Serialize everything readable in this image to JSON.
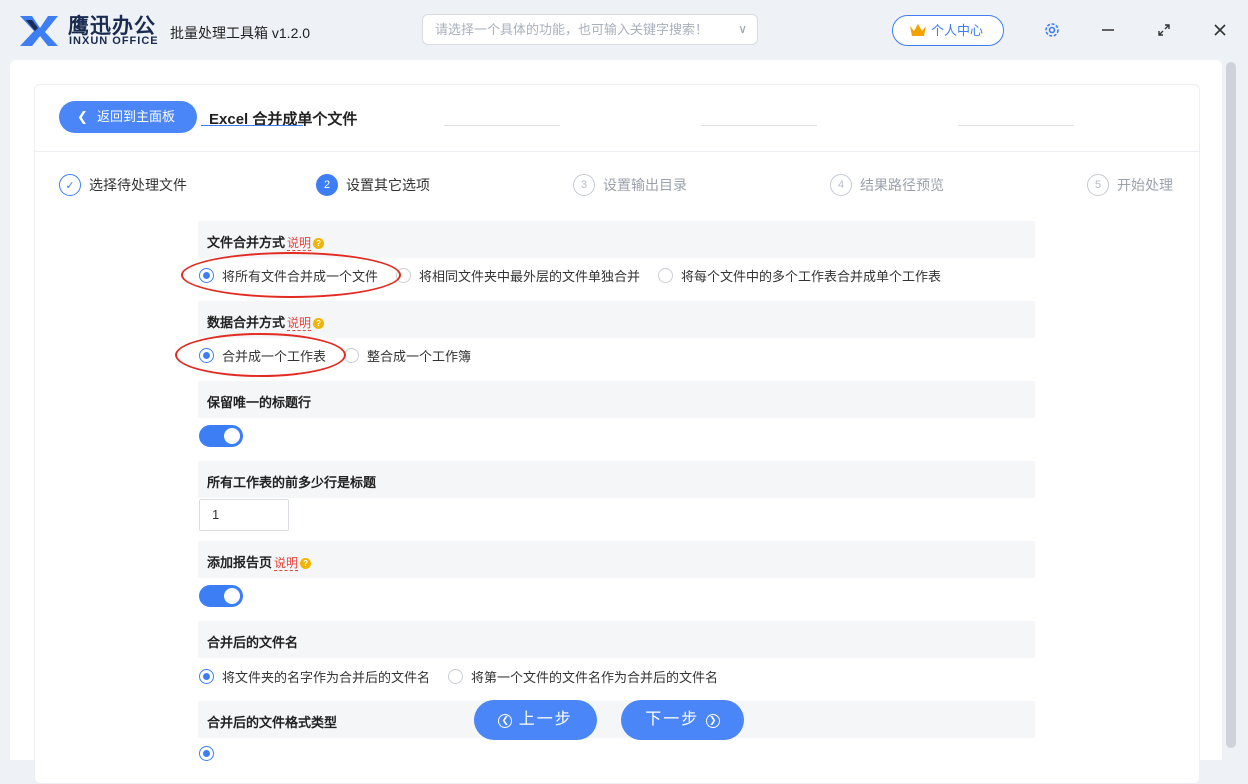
{
  "header": {
    "brand_cn": "鹰迅办公",
    "brand_en": "INXUN OFFICE",
    "app_title": "批量处理工具箱 v1.2.0",
    "search_placeholder": "请选择一个具体的功能，也可输入关键字搜索！",
    "user_center": "个人中心",
    "accent": "#3d7ef5"
  },
  "toolbar": {
    "back_label": "返回到主面板",
    "page_title": "Excel 合并成单个文件"
  },
  "steps": [
    {
      "num": "✓",
      "label": "选择待处理文件",
      "state": "done"
    },
    {
      "num": "2",
      "label": "设置其它选项",
      "state": "active"
    },
    {
      "num": "3",
      "label": "设置输出目录",
      "state": "todo"
    },
    {
      "num": "4",
      "label": "结果路径预览",
      "state": "todo"
    },
    {
      "num": "5",
      "label": "开始处理",
      "state": "todo"
    }
  ],
  "sections": {
    "file_merge": {
      "title": "文件合并方式",
      "tip": "说明",
      "options": [
        "将所有文件合并成一个文件",
        "将相同文件夹中最外层的文件单独合并",
        "将每个文件中的多个工作表合并成单个工作表"
      ],
      "selected": 0
    },
    "data_merge": {
      "title": "数据合并方式",
      "tip": "说明",
      "options": [
        "合并成一个工作表",
        "整合成一个工作簿"
      ],
      "selected": 0
    },
    "keep_header": {
      "title": "保留唯一的标题行",
      "on": true
    },
    "header_rows": {
      "title": "所有工作表的前多少行是标题",
      "value": "1"
    },
    "report_page": {
      "title": "添加报告页",
      "tip": "说明",
      "on": true
    },
    "file_name": {
      "title": "合并后的文件名",
      "options": [
        "将文件夹的名字作为合并后的文件名",
        "将第一个文件的文件名作为合并后的文件名"
      ],
      "selected": 0
    },
    "file_format": {
      "title": "合并后的文件格式类型"
    }
  },
  "nav": {
    "prev_label": "上一步",
    "next_label": "下一步"
  }
}
